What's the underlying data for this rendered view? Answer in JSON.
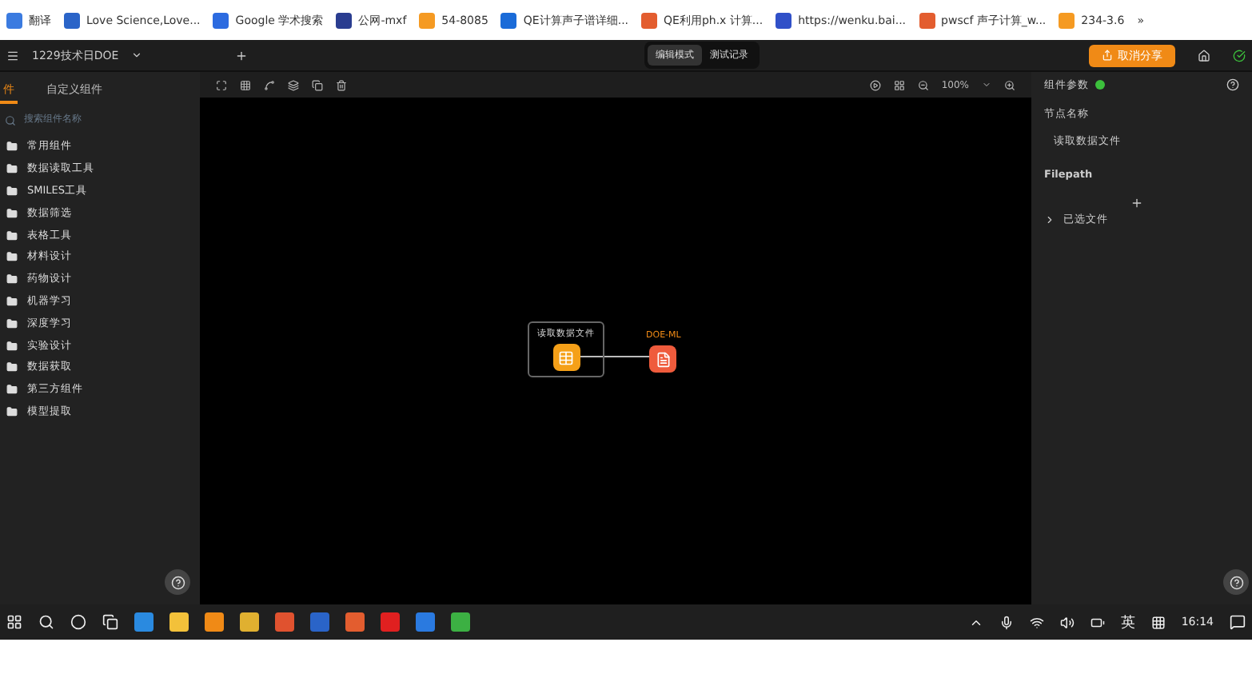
{
  "bookmarks": [
    {
      "label": "翻译"
    },
    {
      "label": "Love Science,Love..."
    },
    {
      "label": "Google 学术搜索"
    },
    {
      "label": "公网-mxf"
    },
    {
      "label": "54-8085"
    },
    {
      "label": "QE计算声子谱详细..."
    },
    {
      "label": "QE利用ph.x 计算..."
    },
    {
      "label": "https://wenku.bai..."
    },
    {
      "label": "pwscf 声子计算_w..."
    },
    {
      "label": "234-3.6"
    }
  ],
  "bookmarks_more": "»",
  "header": {
    "project": "1229技术日DOE",
    "modes": [
      {
        "label": "编辑模式",
        "selected": true
      },
      {
        "label": "测试记录",
        "selected": false
      }
    ],
    "share_button": "取消分享"
  },
  "sidebar": {
    "tabs": [
      {
        "label": "件",
        "selected": true
      },
      {
        "label": "自定义组件",
        "selected": false
      }
    ],
    "search": {
      "placeholder": "搜索组件名称"
    },
    "items": [
      {
        "label": "常用组件"
      },
      {
        "label": "数据读取工具"
      },
      {
        "label": "SMILES工具"
      },
      {
        "label": "数据筛选"
      },
      {
        "label": "表格工具"
      },
      {
        "label": "材料设计"
      },
      {
        "label": "药物设计"
      },
      {
        "label": "机器学习"
      },
      {
        "label": "深度学习"
      },
      {
        "label": "实验设计"
      },
      {
        "label": "数据获取"
      },
      {
        "label": "第三方组件"
      },
      {
        "label": "模型提取"
      }
    ]
  },
  "toolbar": {
    "zoom": "100%"
  },
  "canvas": {
    "nodes": [
      {
        "label": "读取数据文件",
        "kind": "file",
        "selected": true
      },
      {
        "label": "DOE-ML",
        "kind": "model",
        "selected": false
      }
    ]
  },
  "panel": {
    "title": "组件参数",
    "connected": true,
    "node_name_label": "节点名称",
    "node_name": "读取数据文件",
    "filepath_label": "Filepath",
    "selected_files": "已选文件"
  },
  "taskbar": {
    "ime": "英",
    "time": "16:14"
  }
}
